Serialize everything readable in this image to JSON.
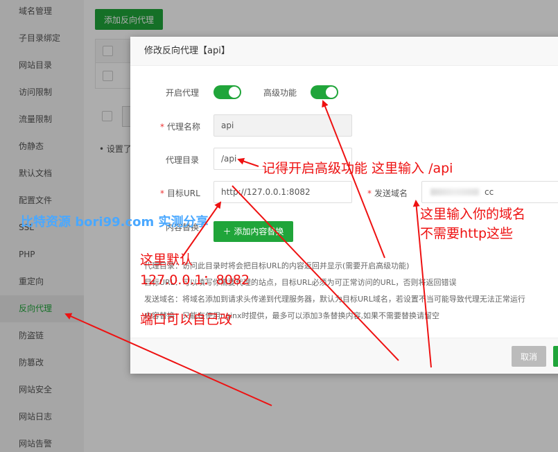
{
  "sidebar": {
    "items": [
      {
        "label": "域名管理"
      },
      {
        "label": "子目录绑定"
      },
      {
        "label": "网站目录"
      },
      {
        "label": "访问限制"
      },
      {
        "label": "流量限制"
      },
      {
        "label": "伪静态"
      },
      {
        "label": "默认文档"
      },
      {
        "label": "配置文件"
      },
      {
        "label": "SSL"
      },
      {
        "label": "PHP"
      },
      {
        "label": "重定向"
      },
      {
        "label": "反向代理",
        "active": true
      },
      {
        "label": "防盗链"
      },
      {
        "label": "防篡改"
      },
      {
        "label": "网站安全"
      },
      {
        "label": "网站日志"
      },
      {
        "label": "网站告警"
      }
    ]
  },
  "main": {
    "add_proxy_label": "添加反向代理",
    "note_text": "设置了"
  },
  "modal": {
    "title": "修改反向代理【api】",
    "enable_proxy_label": "开启代理",
    "enable_proxy_on": true,
    "advanced_label": "高级功能",
    "advanced_on": true,
    "proxy_name_label": "代理名称",
    "proxy_name_value": "api",
    "proxy_dir_label": "代理目录",
    "proxy_dir_value": "/api",
    "target_url_label": "目标URL",
    "target_url_value": "http://127.0.0.1:8082",
    "send_domain_label": "发送域名",
    "send_domain_partial": "cc",
    "content_replace_label": "内容替换",
    "add_content_label": "添加内容替换",
    "desc_lines": [
      "代理目录：访问此目录时将会把目标URL的内容返回并显示(需要开启高级功能)",
      "目标URL：可以填写你需要代理的站点，目标URL必须为可正常访问的URL，否则将返回错误",
      "发送域名：将域名添加到请求头传递到代理服务器，默认为目标URL域名，若设置不当可能导致代理无法正常运行",
      "内容替换：只能在使用nginx时提供，最多可以添加3条替换内容,如果不需要替换请留空"
    ],
    "cancel_label": "取消"
  },
  "annotations": {
    "advanced_hint": "记得开启高级功能  这里输入 /api",
    "domain_hint_1": "这里输入你的域名",
    "domain_hint_2": "不需要http这些",
    "default_hint_1": "这里默认",
    "default_hint_2": "127.0.0.1：8082",
    "default_hint_3": "端口可以自己改",
    "watermark": "比特资源  bori99.com  实测分享"
  },
  "colors": {
    "accent": "#20a53a",
    "annotation": "#ee1111",
    "watermark": "#4aa8ff"
  }
}
